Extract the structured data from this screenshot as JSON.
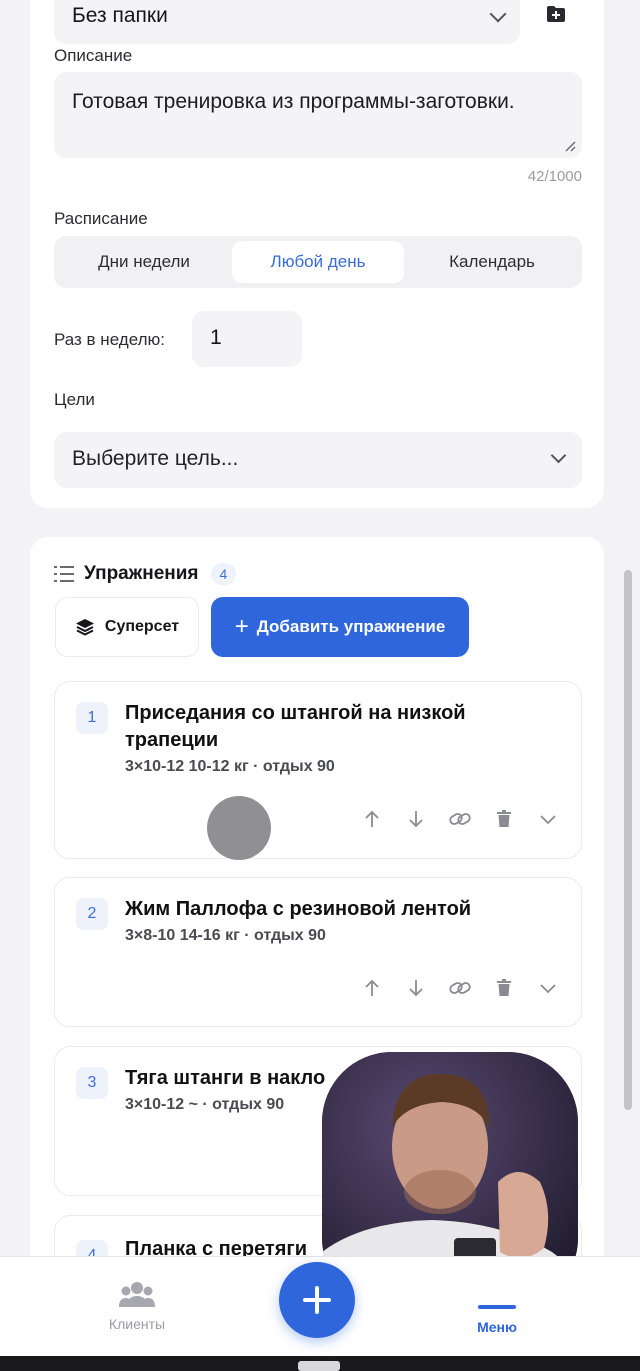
{
  "form": {
    "folder": {
      "value": "Без папки"
    },
    "description": {
      "label": "Описание",
      "value": "Готовая тренировка из программы-заготовки.",
      "counter": "42/1000"
    },
    "schedule": {
      "label": "Расписание",
      "options": [
        "Дни недели",
        "Любой день",
        "Календарь"
      ],
      "selected": "Любой день"
    },
    "frequency": {
      "label": "Раз в неделю:",
      "value": "1"
    },
    "goals": {
      "label": "Цели",
      "placeholder": "Выберите цель..."
    }
  },
  "exercises_section": {
    "title": "Упражнения",
    "count": "4",
    "superset_label": "Суперсет",
    "add_label": "Добавить упражнение",
    "items": [
      {
        "num": "1",
        "title": "Приседания со штангой на низкой трапеции",
        "meta": "3×10-12 10-12 кг · отдых 90"
      },
      {
        "num": "2",
        "title": "Жим Паллофа с резиновой лентой",
        "meta": "3×8-10 14-16 кг · отдых 90"
      },
      {
        "num": "3",
        "title": "Тяга штанги в накло",
        "meta": "3×10-12 ~ · отдых 90"
      },
      {
        "num": "4",
        "title": "Планка с перетяги",
        "meta": ""
      }
    ]
  },
  "bottom_nav": {
    "clients_label": "Клиенты",
    "menu_label": "Меню"
  },
  "colors": {
    "accent": "#2f66dc",
    "background": "#f3f3f5",
    "card": "#ffffff"
  },
  "icons": [
    "folder-add-icon",
    "chevron-down-icon",
    "list-icon",
    "layers-icon",
    "plus-icon",
    "arrow-up-icon",
    "arrow-down-icon",
    "link-icon",
    "trash-icon",
    "users-icon",
    "resize-grip-icon"
  ]
}
